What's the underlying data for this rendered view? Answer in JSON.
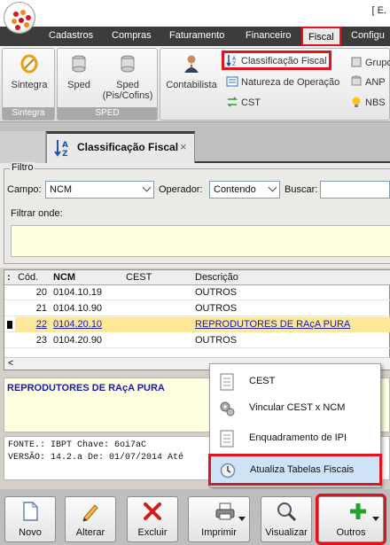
{
  "window": {
    "title_fragment": "[ E."
  },
  "menu": [
    "Cadastros",
    "Compras",
    "Faturamento",
    "Financeiro",
    "Fiscal",
    "Configu"
  ],
  "menu_active": "Fiscal",
  "ribbon": {
    "sintegra_group": {
      "label": "Sintegra",
      "button": "Sintegra"
    },
    "sped_group": {
      "label": "SPED",
      "sped": "Sped",
      "sped_pis_line1": "Sped",
      "sped_pis_line2": "(Pis/Cofins)"
    },
    "fiscal_group": {
      "contabilista": "Contabilista",
      "classificacao": "Classificação Fiscal",
      "natureza": "Natureza de Operação",
      "cest": "CST"
    },
    "right_group": {
      "grupo": "Grupo",
      "anp": "ANP",
      "nbs": "NBS"
    }
  },
  "tab": {
    "title": "Classificação Fiscal",
    "close": "×"
  },
  "filter": {
    "legend": "Filtro",
    "campo_label": "Campo:",
    "campo_value": "NCM",
    "operador_label": "Operador:",
    "operador_value": "Contendo",
    "buscar_label": "Buscar:",
    "filtrar_onde": "Filtrar onde:"
  },
  "grid": {
    "columns": [
      ":",
      "Cód.",
      "NCM",
      "CEST",
      "Descrição"
    ],
    "rows": [
      {
        "cod": "20",
        "ncm": "0104.10.19",
        "cest": "",
        "desc": "OUTROS",
        "selected": false
      },
      {
        "cod": "21",
        "ncm": "0104.10.90",
        "cest": "",
        "desc": "OUTROS",
        "selected": false
      },
      {
        "cod": "22",
        "ncm": "0104.20.10",
        "cest": "",
        "desc": "REPRODUTORES DE RAçA PURA",
        "selected": true
      },
      {
        "cod": "23",
        "ncm": "0104.20.90",
        "cest": "",
        "desc": "OUTROS",
        "selected": false
      }
    ],
    "scroll_left": "<"
  },
  "detail": {
    "text": "REPRODUTORES DE RAçA PURA"
  },
  "source": {
    "line1": "FONTE.: IBPT Chave: 6oi7aC",
    "line2": "VERSÃO: 14.2.a De: 01/07/2014 Até"
  },
  "popup": {
    "items": [
      {
        "label": "CEST",
        "icon": "document-icon"
      },
      {
        "label": "Vincular CEST x NCM",
        "icon": "gears-icon"
      },
      {
        "label": "Enquadramento de IPI",
        "icon": "document-icon"
      },
      {
        "label": "Atualiza Tabelas Fiscais",
        "icon": "clock-icon",
        "highlighted": true
      }
    ]
  },
  "toolbar": {
    "novo": "Novo",
    "alterar": "Alterar",
    "excluir": "Excluir",
    "imprimir": "Imprimir",
    "visualizar": "Visualizar",
    "outros": "Outros"
  },
  "colors": {
    "accent_red": "#e0131e",
    "menu_bg": "#3c3c3c",
    "selected_row": "#fde89a",
    "link_blue": "#1a1aa8"
  }
}
